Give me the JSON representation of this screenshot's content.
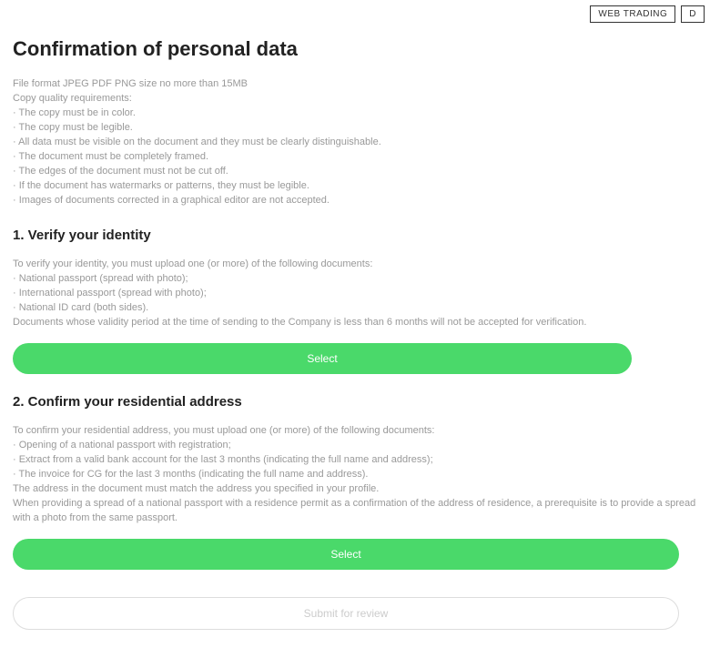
{
  "topbar": {
    "web_trading": "WEB TRADING",
    "partial": "D"
  },
  "page_title": "Confirmation of personal data",
  "intro": {
    "file_format": "File format JPEG PDF PNG size no more than 15MB",
    "copy_quality_heading": "Copy quality requirements:",
    "reqs": [
      "· The copy must be in color.",
      "· The copy must be legible.",
      "· All data must be visible on the document and they must be clearly distinguishable.",
      "· The document must be completely framed.",
      "· The edges of the document must not be cut off.",
      "· If the document has watermarks or patterns, they must be legible.",
      "· Images of documents corrected in a graphical editor are not accepted."
    ]
  },
  "section1": {
    "title": "1. Verify your identity",
    "lead": "To verify your identity, you must upload one (or more) of the following documents:",
    "items": [
      "· National passport (spread with photo);",
      "· International passport (spread with photo);",
      "· National ID card (both sides)."
    ],
    "note": "Documents whose validity period at the time of sending to the Company is less than 6 months will not be accepted for verification.",
    "button": "Select"
  },
  "section2": {
    "title": "2. Confirm your residential address",
    "lead": "To confirm your residential address, you must upload one (or more) of the following documents:",
    "items": [
      "· Opening of a national passport with registration;",
      "· Extract from a valid bank account for the last 3 months (indicating the full name and address);",
      "· The invoice for CG for the last 3 months (indicating the full name and address)."
    ],
    "note1": "The address in the document must match the address you specified in your profile.",
    "note2": "When providing a spread of a national passport with a residence permit as a confirmation of the address of residence, a prerequisite is to provide a spread with a photo from the same passport.",
    "button": "Select"
  },
  "submit_label": "Submit for review"
}
